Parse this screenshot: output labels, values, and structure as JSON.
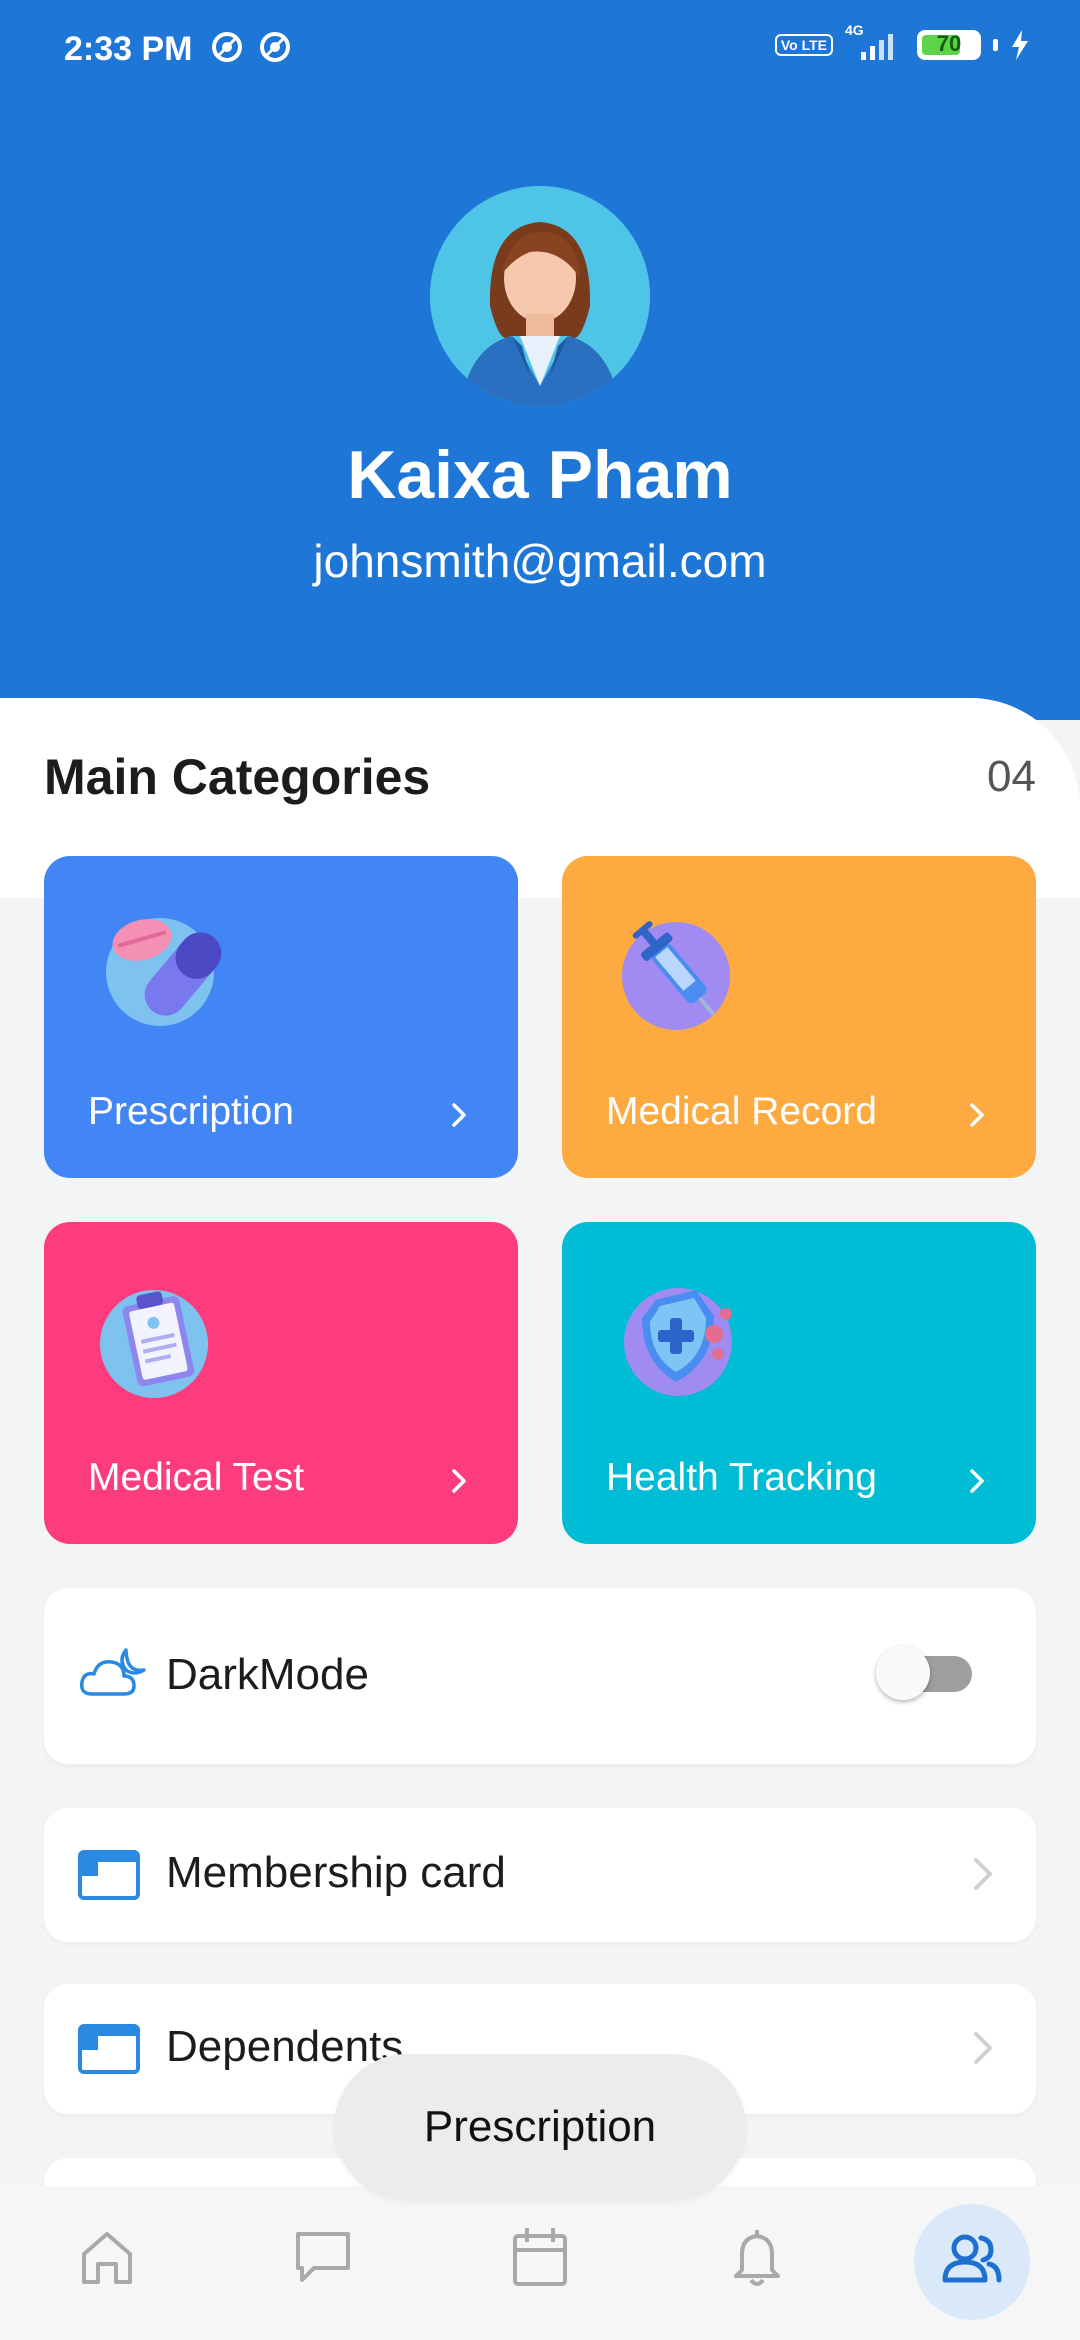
{
  "status_bar": {
    "time": "2:33 PM",
    "volte": "Vo LTE",
    "network": "4G",
    "battery": "70"
  },
  "profile": {
    "name": "Kaixa Pham",
    "email": "johnsmith@gmail.com"
  },
  "categories": {
    "title": "Main Categories",
    "count": "04",
    "items": [
      {
        "label": "Prescription",
        "color": "#4286f5",
        "icon": "pills-icon"
      },
      {
        "label": "Medical Record",
        "color": "#fdaa40",
        "icon": "syringe-icon"
      },
      {
        "label": "Medical Test",
        "color": "#fc3c7d",
        "icon": "clipboard-icon"
      },
      {
        "label": "Health Tracking",
        "color": "#00bcd5",
        "icon": "shield-icon"
      }
    ]
  },
  "settings": {
    "dark_mode": {
      "label": "DarkMode",
      "enabled": false
    },
    "membership": {
      "label": "Membership card"
    },
    "dependents": {
      "label": "Dependents"
    }
  },
  "toast": {
    "text": "Prescription"
  },
  "bottom_nav": {
    "items": [
      "home-icon",
      "chat-icon",
      "calendar-icon",
      "bell-icon",
      "profile-icon"
    ],
    "active": "profile-icon"
  }
}
